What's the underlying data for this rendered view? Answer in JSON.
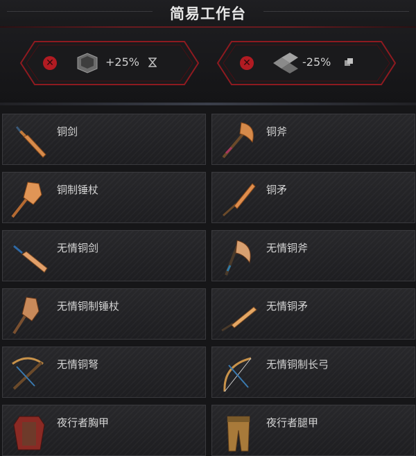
{
  "header": {
    "title": "简易工作台"
  },
  "bonuses": [
    {
      "value": "+25%",
      "icon": "metal-box-icon",
      "small_icon": "hourglass-icon"
    },
    {
      "value": "-25%",
      "icon": "ingot-stack-icon",
      "small_icon": "resource-icon"
    }
  ],
  "recipes": [
    {
      "name": "铜剑",
      "icon": "copper-sword-icon"
    },
    {
      "name": "铜斧",
      "icon": "copper-axe-icon"
    },
    {
      "name": "铜制锤杖",
      "icon": "copper-mace-icon"
    },
    {
      "name": "铜矛",
      "icon": "copper-spear-icon"
    },
    {
      "name": "无情铜剑",
      "icon": "ruthless-copper-sword-icon"
    },
    {
      "name": "无情铜斧",
      "icon": "ruthless-copper-axe-icon"
    },
    {
      "name": "无情铜制锤杖",
      "icon": "ruthless-copper-mace-icon"
    },
    {
      "name": "无情铜矛",
      "icon": "ruthless-copper-spear-icon"
    },
    {
      "name": "无情铜弩",
      "icon": "ruthless-copper-crossbow-icon"
    },
    {
      "name": "无情铜制长弓",
      "icon": "ruthless-copper-longbow-icon"
    },
    {
      "name": "夜行者胸甲",
      "icon": "nightwalker-chestplate-icon"
    },
    {
      "name": "夜行者腿甲",
      "icon": "nightwalker-leggings-icon"
    }
  ]
}
